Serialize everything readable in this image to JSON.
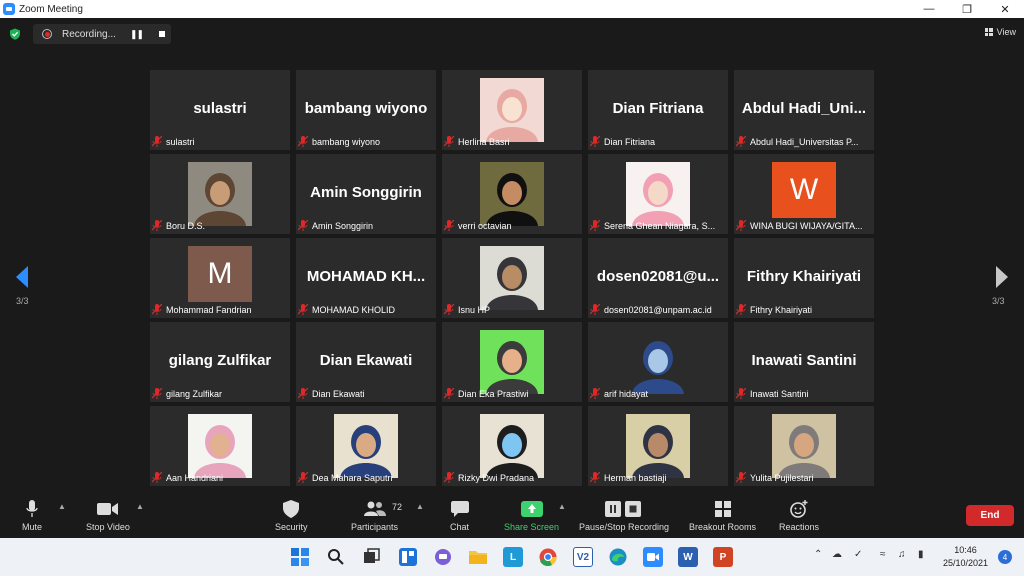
{
  "window": {
    "title": "Zoom Meeting"
  },
  "recording": {
    "label": "Recording...",
    "pause_icon": "pause-icon",
    "stop_icon": "stop-icon"
  },
  "view": {
    "label": "View"
  },
  "pager": {
    "left": "3/3",
    "right": "3/3"
  },
  "tiles": [
    {
      "label": "sulastri",
      "big": "sulastri",
      "video": null
    },
    {
      "label": "bambang wiyono",
      "big": "bambang wiyono",
      "video": null
    },
    {
      "label": "Herlina Basri",
      "big": "",
      "video": "pink-hijab"
    },
    {
      "label": "Dian Fitriana",
      "big": "Dian Fitriana",
      "video": null
    },
    {
      "label": "Abdul Hadi_Universitas P...",
      "big": "Abdul  Hadi_Uni...",
      "video": null
    },
    {
      "label": "Boru D.S.",
      "big": "",
      "video": "man-hat"
    },
    {
      "label": "Amin Songgirin",
      "big": "Amin Songgirin",
      "video": null
    },
    {
      "label": "verri octavian",
      "big": "",
      "video": "man-suit"
    },
    {
      "label": "Serena Ghean Niagara, S...",
      "big": "",
      "video": "pink-hijab-2"
    },
    {
      "label": "WINA BUGI WIJAYA/GITA...",
      "big": "",
      "video": "avatar-w"
    },
    {
      "label": "Mohammad Fandrian",
      "big": "",
      "video": "avatar-m"
    },
    {
      "label": "MOHAMAD KHOLID",
      "big": "MOHAMAD  KH...",
      "video": null
    },
    {
      "label": "Isnu HP",
      "big": "",
      "video": "man-glasses"
    },
    {
      "label": "dosen02081@unpam.ac.id",
      "big": "dosen02081@u...",
      "video": null
    },
    {
      "label": "Fithry Khairiyati",
      "big": "Fithry Khairiyati",
      "video": null
    },
    {
      "label": "gilang Zulfikar",
      "big": "gilang Zulfikar",
      "video": null
    },
    {
      "label": "Dian Ekawati",
      "big": "Dian Ekawati",
      "video": null
    },
    {
      "label": "Dian Eka Prastiwi",
      "big": "",
      "video": "woman-green"
    },
    {
      "label": "arif hidayat",
      "big": "",
      "video": "game-character"
    },
    {
      "label": "Inawati Santini",
      "big": "Inawati Santini",
      "video": null
    },
    {
      "label": "Aan Handriani",
      "big": "",
      "video": "woman-pink"
    },
    {
      "label": "Dea Mahara Saputri",
      "big": "",
      "video": "woman-blue-hijab"
    },
    {
      "label": "Rizky Dwi Pradana",
      "big": "",
      "video": "man-mask"
    },
    {
      "label": "Herman bastiaji",
      "big": "",
      "video": "man-office"
    },
    {
      "label": "Yulita Pujilestari",
      "big": "",
      "video": "woman-grey-hijab"
    }
  ],
  "avatars": {
    "w_letter": "W",
    "m_letter": "M",
    "w_color": "#e8501e",
    "m_color": "#7d5a4b"
  },
  "toolbar": {
    "mute": "Mute",
    "stop_video": "Stop Video",
    "security": "Security",
    "participants": "Participants",
    "participants_count": "72",
    "chat": "Chat",
    "share_screen": "Share Screen",
    "pause_stop_recording": "Pause/Stop Recording",
    "breakout_rooms": "Breakout Rooms",
    "reactions": "Reactions",
    "end": "End"
  },
  "taskbar": {
    "time": "10:46",
    "date": "25/10/2021",
    "notifications": "4",
    "vs_label": "V2",
    "l_label": "L"
  },
  "colors": {
    "accent_green": "#3ed16f",
    "end_red": "#d22a2a",
    "zoom_blue": "#2d8cff",
    "mic_off_red": "#e02828"
  }
}
